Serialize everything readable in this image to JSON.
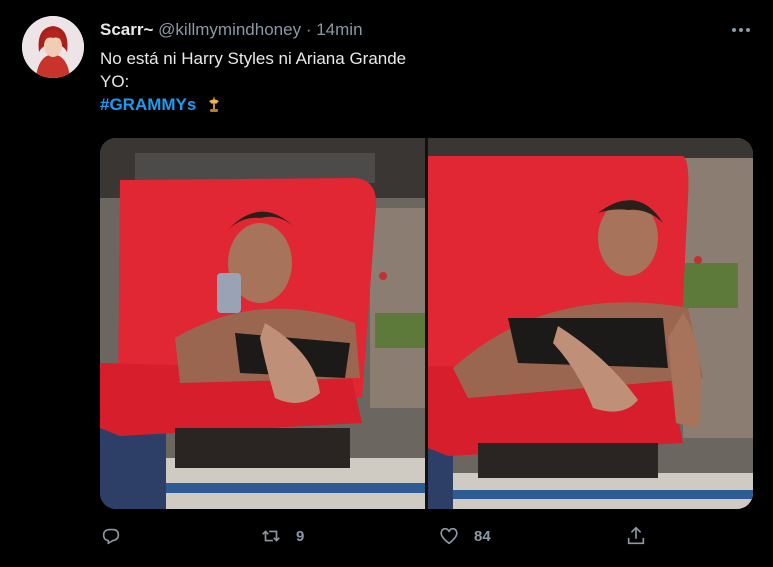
{
  "author": {
    "name": "Scarr~",
    "handle": "@killmymindhoney",
    "separator": "·",
    "time": "14min"
  },
  "tweet": {
    "line1": "No está ni Harry Styles ni Ariana Grande",
    "line2": "YO:",
    "hashtag": "#GRAMMYs"
  },
  "actions": {
    "retweets": "9",
    "likes": "84"
  },
  "icons": [
    "more-icon",
    "reply-icon",
    "retweet-icon",
    "like-icon",
    "share-icon",
    "grammy-icon"
  ],
  "colors": {
    "background": "#000000",
    "link": "#1d9bf0",
    "secondary": "#8b98a5"
  }
}
